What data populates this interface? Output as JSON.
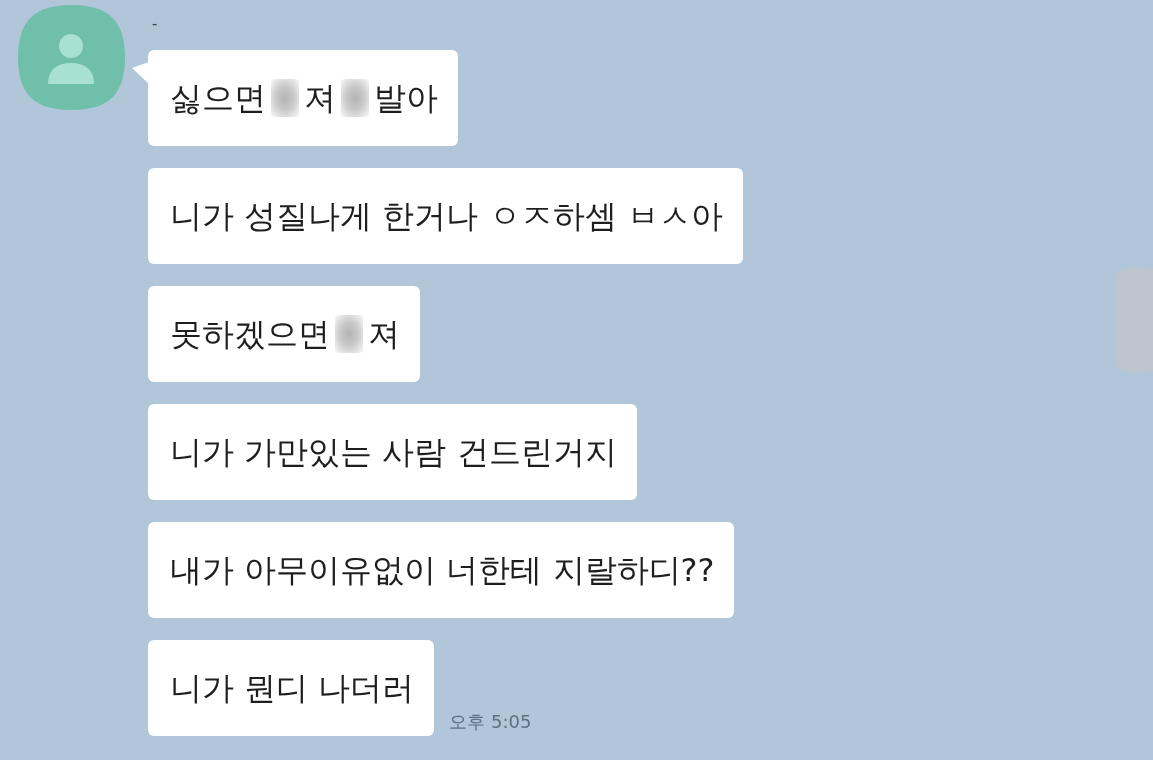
{
  "chat": {
    "sender": {
      "name": "-"
    },
    "messages": [
      {
        "tail": true,
        "parts": [
          {
            "kind": "text",
            "text": "싫으면"
          },
          {
            "kind": "blur"
          },
          {
            "kind": "text",
            "text": "져"
          },
          {
            "kind": "blur"
          },
          {
            "kind": "text",
            "text": "발아"
          }
        ]
      },
      {
        "tail": false,
        "parts": [
          {
            "kind": "text",
            "text": "니가 성질나게 한거나 ㅇㅈ하셈 ㅂㅅ아"
          }
        ]
      },
      {
        "tail": false,
        "parts": [
          {
            "kind": "text",
            "text": "못하겠으면"
          },
          {
            "kind": "blur"
          },
          {
            "kind": "text",
            "text": "져"
          }
        ]
      },
      {
        "tail": false,
        "parts": [
          {
            "kind": "text",
            "text": "니가 가만있는 사람 건드린거지"
          }
        ]
      },
      {
        "tail": false,
        "parts": [
          {
            "kind": "text",
            "text": "내가 아무이유없이 너한테 지랄하디??"
          }
        ]
      },
      {
        "tail": false,
        "parts": [
          {
            "kind": "text",
            "text": "니가 뭔디 나더러"
          }
        ],
        "time": "오후 5:05"
      }
    ]
  }
}
